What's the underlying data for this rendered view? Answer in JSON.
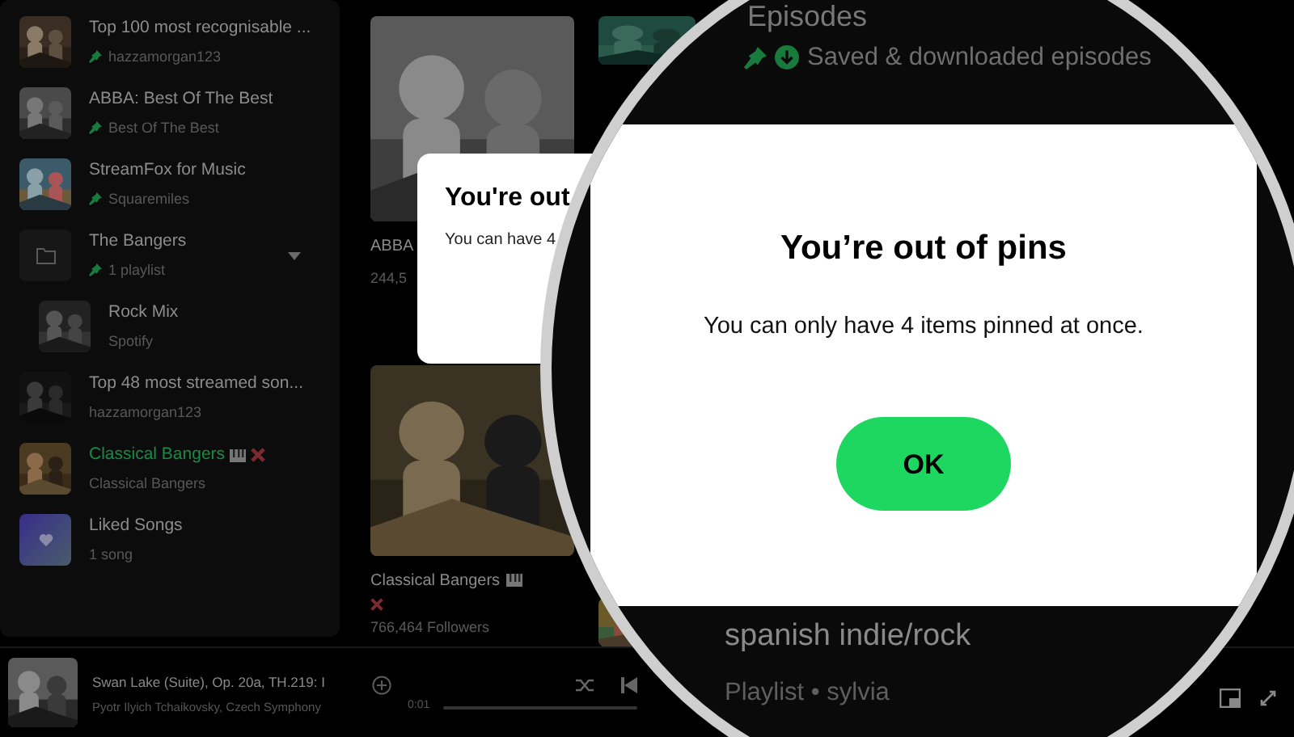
{
  "sidebar": {
    "items": [
      {
        "kind": "playlist",
        "title": "Top 100 most recognisable ...",
        "subtitle": "hazzamorgan123",
        "pinned": true,
        "active": false
      },
      {
        "kind": "playlist",
        "title": "ABBA: Best Of The Best",
        "subtitle": "Best Of The Best",
        "pinned": true,
        "active": false
      },
      {
        "kind": "playlist",
        "title": "StreamFox for Music",
        "subtitle": "Squaremiles",
        "pinned": true,
        "active": false
      },
      {
        "kind": "folder",
        "title": "The Bangers",
        "subtitle": "1 playlist",
        "pinned": true,
        "active": false,
        "expanded": true,
        "children": [
          {
            "kind": "playlist",
            "title": "Rock Mix",
            "subtitle": "Spotify",
            "pinned": false,
            "active": false
          }
        ]
      },
      {
        "kind": "playlist",
        "title": "Top 48 most streamed son...",
        "subtitle": "hazzamorgan123",
        "pinned": false,
        "active": false
      },
      {
        "kind": "playlist",
        "title": "Classical Bangers",
        "subtitle": "Classical Bangers",
        "pinned": false,
        "active": true
      },
      {
        "kind": "liked",
        "title": "Liked Songs",
        "subtitle": "1 song",
        "pinned": false,
        "active": false
      }
    ]
  },
  "cards": [
    {
      "title": "ABBA",
      "subtitle": "244,5"
    },
    {
      "title": "Classical Bangers",
      "subtitle": "766,464 Followers"
    }
  ],
  "small_dialog": {
    "title": "You're out",
    "message": "You can have 4"
  },
  "player": {
    "track": "Swan Lake (Suite), Op. 20a, TH.219: I",
    "artist": "Pyotr Ilyich Tchaikovsky, Czech Symphony",
    "elapsed": "0:01"
  },
  "magnifier": {
    "header": "Episodes",
    "saved_subtitle": "Saved & downloaded episodes",
    "dialog": {
      "title": "You’re out of pins",
      "message": "You can only have 4 items pinned at once.",
      "button": "OK"
    },
    "playlist": {
      "title": "spanish indie/rock",
      "subtitle": "Playlist • sylvia"
    }
  }
}
